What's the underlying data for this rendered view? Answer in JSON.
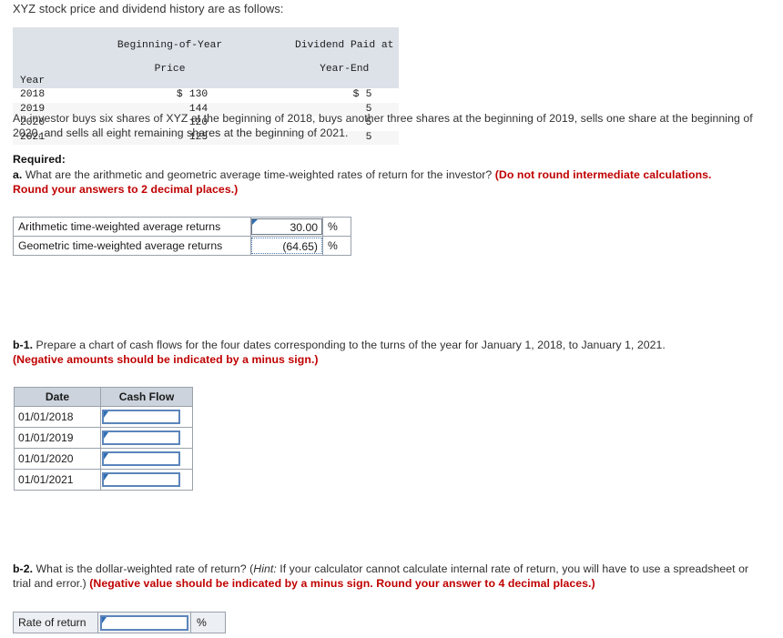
{
  "intro": "XYZ stock price and dividend history are as follows:",
  "data_table": {
    "headers": {
      "year": "Year",
      "price_line1": "Beginning-of-Year",
      "price_line2": "Price",
      "dividend_line1": "Dividend Paid at",
      "dividend_line2": "Year-End"
    },
    "rows": [
      {
        "year": "2018",
        "currency_price": "$",
        "price": "130",
        "currency_div": "$",
        "dividend": "5"
      },
      {
        "year": "2019",
        "currency_price": "",
        "price": "144",
        "currency_div": "",
        "dividend": "5"
      },
      {
        "year": "2020",
        "currency_price": "",
        "price": "120",
        "currency_div": "",
        "dividend": "5"
      },
      {
        "year": "2021",
        "currency_price": "",
        "price": "125",
        "currency_div": "",
        "dividend": "5"
      }
    ]
  },
  "scenario": "An investor buys six shares of XYZ at the beginning of 2018, buys another three shares at the beginning of 2019, sells one share at the beginning of 2020, and sells all eight remaining shares at the beginning of 2021.",
  "required_heading": "Required:",
  "part_a": {
    "marker": "a.",
    "question": " What are the arithmetic and geometric average time-weighted rates of return for the investor? ",
    "instruction": "(Do not round intermediate calculations. Round your answers to 2 decimal places.)",
    "rows": [
      {
        "label": "Arithmetic time-weighted average returns",
        "value": "30.00",
        "unit": "%"
      },
      {
        "label": "Geometric time-weighted average returns",
        "value": "(64.65)",
        "unit": "%"
      }
    ]
  },
  "part_b1": {
    "marker": "b-1.",
    "question": " Prepare a chart of cash flows for the four dates corresponding to the turns of the year for January 1, 2018, to January 1, 2021.",
    "instruction": "(Negative amounts should be indicated by a minus sign.)",
    "headers": {
      "date": "Date",
      "cash_flow": "Cash Flow"
    },
    "rows": [
      {
        "date": "01/01/2018",
        "cash_flow": ""
      },
      {
        "date": "01/01/2019",
        "cash_flow": ""
      },
      {
        "date": "01/01/2020",
        "cash_flow": ""
      },
      {
        "date": "01/01/2021",
        "cash_flow": ""
      }
    ]
  },
  "part_b2": {
    "marker": "b-2.",
    "question_part1": " What is the dollar-weighted rate of return? (",
    "hint_label": "Hint:",
    "question_part2": " If your calculator cannot calculate internal rate of return, you will have to use a spreadsheet or trial and error.) ",
    "instruction": "(Negative value should be indicated by a minus sign. Round your answer to 4 decimal places.)",
    "row": {
      "label": "Rate of return",
      "value": "",
      "unit": "%"
    }
  },
  "colors": {
    "header_blue_gray": "#dde2e9",
    "cf_header": "#ccd3dd",
    "input_border_blue": "#5b85bb",
    "flag_blue": "#2f6fb4",
    "red_instruction": "#c00000",
    "grid_border": "#9aa1aa"
  }
}
